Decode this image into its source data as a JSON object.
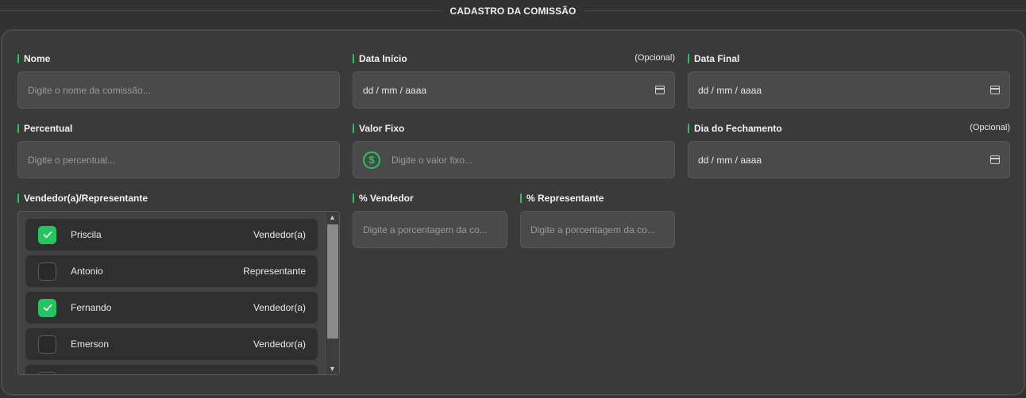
{
  "header": {
    "title": "CADASTRO DA COMISSÃO"
  },
  "fields": {
    "nome": {
      "label": "Nome",
      "placeholder": "Digite o nome da comissão..."
    },
    "data_inicio": {
      "label": "Data Início",
      "optional": "(Opcional)",
      "value": "dd / mm / aaaa"
    },
    "data_final": {
      "label": "Data Final",
      "value": "dd / mm / aaaa"
    },
    "percentual": {
      "label": "Percentual",
      "placeholder": "Digite o percentual..."
    },
    "valor_fixo": {
      "label": "Valor Fixo",
      "placeholder": "Digite o valor fixo...",
      "icon": "dollar-circle-icon"
    },
    "dia_fechamento": {
      "label": "Dia do Fechamento",
      "optional": "(Opcional)",
      "value": "dd / mm / aaaa"
    },
    "vendedores": {
      "label": "Vendedor(a)/Representante"
    },
    "pct_vendedor": {
      "label": "% Vendedor",
      "placeholder": "Digite a porcentagem da co..."
    },
    "pct_representante": {
      "label": "% Representante",
      "placeholder": "Digite a porcentagem da co..."
    }
  },
  "sellers": [
    {
      "name": "Priscila",
      "role": "Vendedor(a)",
      "checked": true
    },
    {
      "name": "Antonio",
      "role": "Representante",
      "checked": false
    },
    {
      "name": "Fernando",
      "role": "Vendedor(a)",
      "checked": true
    },
    {
      "name": "Emerson",
      "role": "Vendedor(a)",
      "checked": false
    },
    {
      "name": "",
      "role": "",
      "checked": false
    }
  ],
  "colors": {
    "accent": "#22c55e",
    "background": "#323232",
    "panel": "#3a3a3a",
    "input": "#4a4a4a"
  }
}
